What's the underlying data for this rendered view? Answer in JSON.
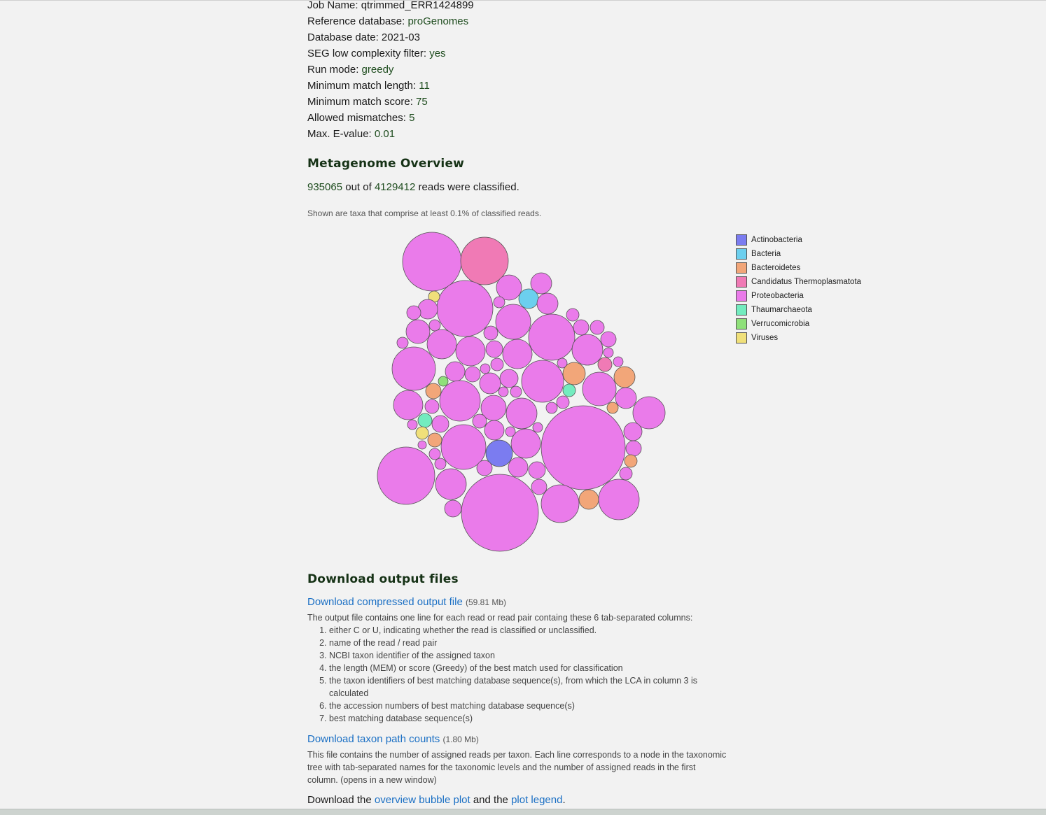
{
  "params": [
    {
      "label": "Job Name:",
      "value": "qtrimmed_ERR1424899",
      "plain": true
    },
    {
      "label": "Reference database:",
      "value": "proGenomes"
    },
    {
      "label": "Database date:",
      "value": "2021-03",
      "plain": true
    },
    {
      "label": "SEG low complexity filter:",
      "value": "yes"
    },
    {
      "label": "Run mode:",
      "value": "greedy"
    },
    {
      "label": "Minimum match length:",
      "value": "11"
    },
    {
      "label": "Minimum match score:",
      "value": "75"
    },
    {
      "label": "Allowed mismatches:",
      "value": "5"
    },
    {
      "label": "Max. E-value:",
      "value": "0.01"
    }
  ],
  "overview": {
    "heading": "Metagenome Overview",
    "classified": "935065",
    "out_of": "out of",
    "total": "4129412",
    "reads_classified": "reads were classified.",
    "note": "Shown are taxa that comprise at least 0.1% of classified reads."
  },
  "legend": [
    {
      "name": "Actinobacteria",
      "color": "#7b7cf0"
    },
    {
      "name": "Bacteria",
      "color": "#6ccfee"
    },
    {
      "name": "Bacteroidetes",
      "color": "#f2a679"
    },
    {
      "name": "Candidatus Thermoplasmatota",
      "color": "#f07ab5"
    },
    {
      "name": "Proteobacteria",
      "color": "#ea7bea"
    },
    {
      "name": "Thaumarchaeota",
      "color": "#73ecbf"
    },
    {
      "name": "Verrucomicrobia",
      "color": "#8fe07a"
    },
    {
      "name": "Viruses",
      "color": "#f0e07a"
    }
  ],
  "downloads": {
    "heading": "Download output files",
    "file1": {
      "link": "Download compressed output file",
      "size": "(59.81 Mb)",
      "desc": "The output file contains one line for each read or read pair containg these 6 tab-separated columns:",
      "columns": [
        "either C or U, indicating whether the read is classified or unclassified.",
        "name of the read / read pair",
        "NCBI taxon identifier of the assigned taxon",
        "the length (MEM) or score (Greedy) of the best match used for classification",
        "the taxon identifiers of best matching database sequence(s), from which the LCA in column 3 is calculated",
        "the accession numbers of best matching database sequence(s)",
        "best matching database sequence(s)"
      ]
    },
    "file2": {
      "link": "Download taxon path counts",
      "size": "(1.80 Mb)",
      "desc": "This file contains the number of assigned reads per taxon. Each line corresponds to a node in the taxonomic tree with tab-separated names for the taxonomic levels and the number of assigned reads in the first column. (opens in a new window)"
    },
    "final": {
      "prefix": "Download the",
      "link1": "overview bubble plot",
      "middle": "and the",
      "link2": "plot legend",
      "suffix": "."
    }
  }
}
